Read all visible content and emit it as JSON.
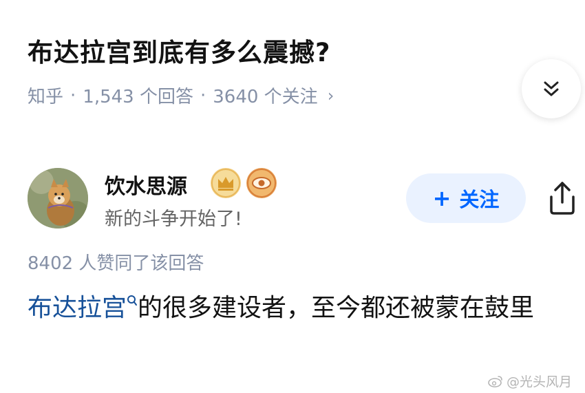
{
  "question": {
    "title": "布达拉宫到底有多么震撼?",
    "source": "知乎",
    "answers": "1,543 个回答",
    "followers": "3640 个关注",
    "separator": "·",
    "chevron": "›"
  },
  "author": {
    "name": "饮水思源",
    "bio": "新的斗争开始了!",
    "badges": [
      "crown-badge-icon",
      "eye-badge-icon"
    ]
  },
  "actions": {
    "follow_plus": "+",
    "follow_label": "关注",
    "collapse_icon": "double-chevron-down-icon",
    "share_icon": "share-icon"
  },
  "answer": {
    "votes": "8402 人赞同了该回答",
    "keyword": "布达拉宫",
    "text": "的很多建设者，至今都还被蒙在鼓里"
  },
  "watermark": {
    "text": "@光头风月"
  },
  "colors": {
    "link": "#175199",
    "accent": "#0066ff",
    "muted": "#8590a6"
  }
}
